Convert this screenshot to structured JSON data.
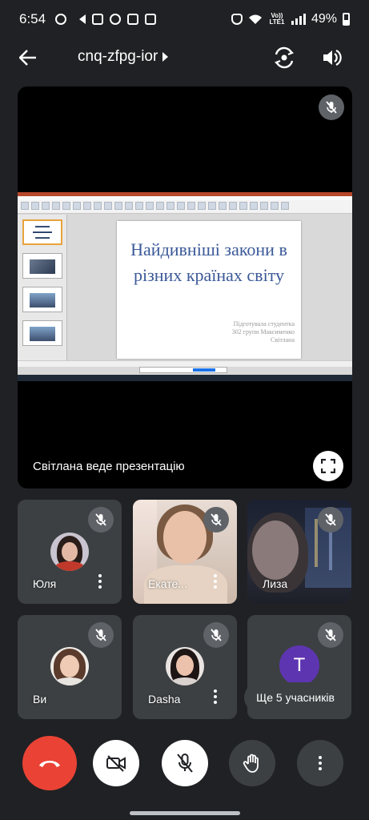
{
  "status_bar": {
    "time": "6:54",
    "network_label": "Vo)) LTE1",
    "battery": "49%"
  },
  "header": {
    "meeting_code": "cnq-zfpg-ior"
  },
  "presentation": {
    "presenter_label": "Світлана веде презентацію",
    "slide": {
      "title": "Найдивніші закони в різних країнах світу",
      "subtitle": "Підготувала студентка 302 групи Максименко Світлана"
    }
  },
  "participants": [
    {
      "name": "Юля",
      "camera": "off",
      "muted": true
    },
    {
      "name": "Екате...",
      "camera": "on",
      "muted": true
    },
    {
      "name": "Лиза",
      "camera": "on",
      "muted": true
    },
    {
      "name": "Ви",
      "camera": "off",
      "muted": true
    },
    {
      "name": "Dasha",
      "camera": "off",
      "muted": true
    },
    {
      "name": "",
      "camera": "off",
      "muted": true,
      "initial": "T"
    }
  ],
  "more_participants_label": "Ще 5 учасників",
  "controls": [
    "end-call",
    "camera-off",
    "mic-off",
    "raise-hand",
    "more-options"
  ],
  "colors": {
    "background": "#202124",
    "tile": "#3c4043",
    "end_call": "#ea4335",
    "avatar_t": "#5e35b1",
    "slide_title": "#3b5998"
  }
}
